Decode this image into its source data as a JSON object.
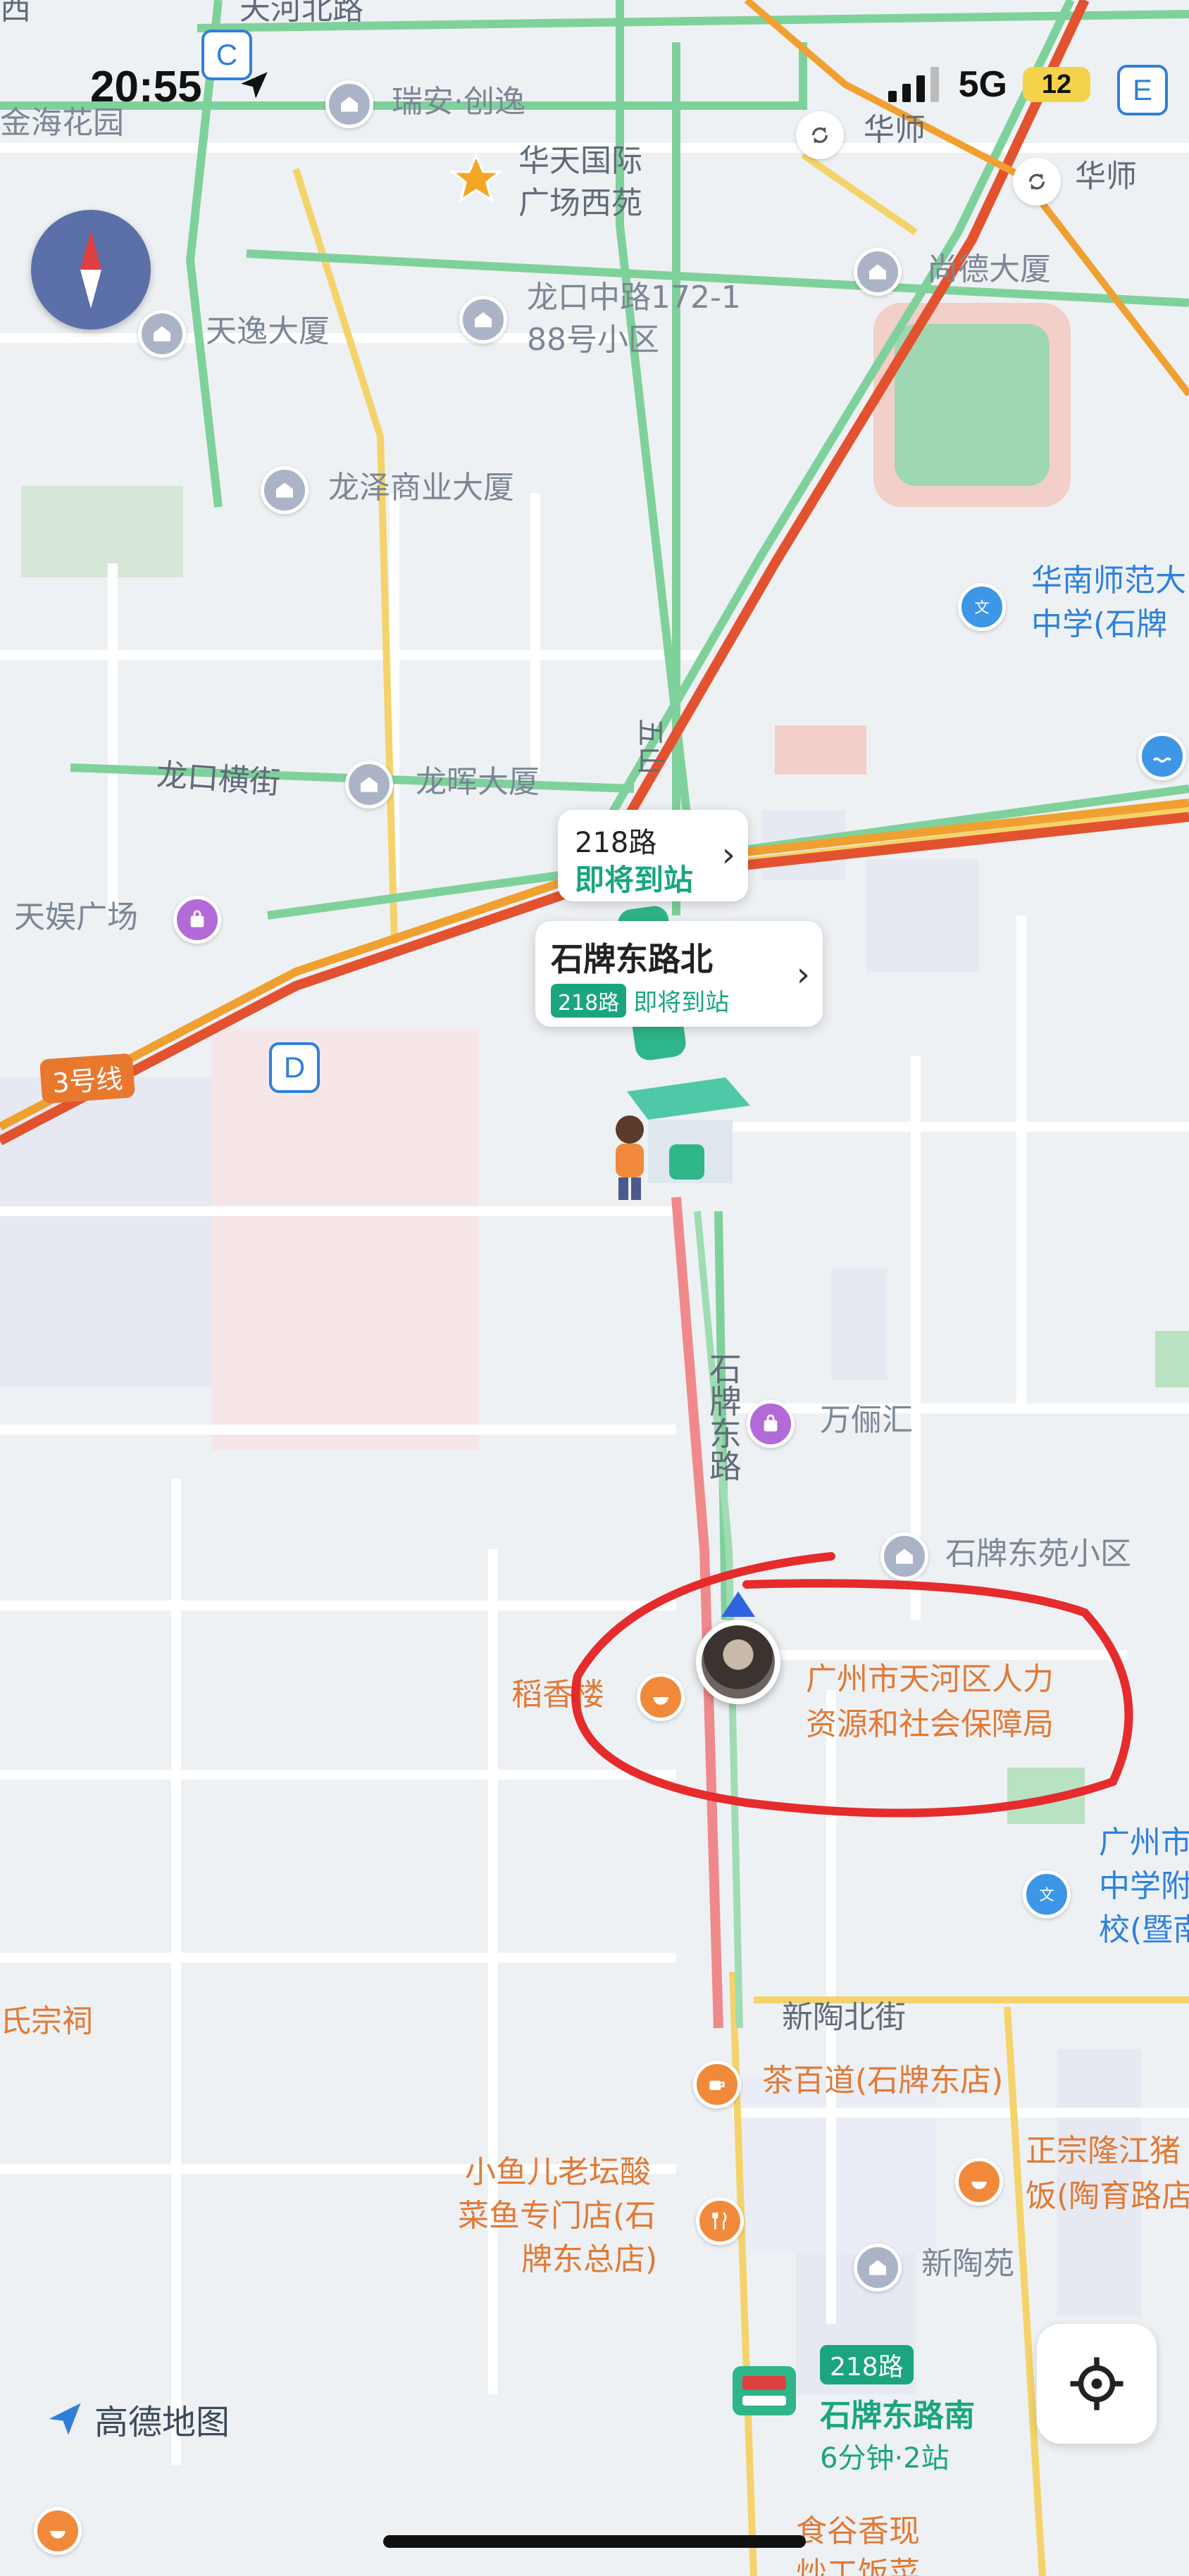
{
  "status_bar": {
    "time": "20:55",
    "network": "5G",
    "battery": "12"
  },
  "badges": {
    "top_left": "C",
    "top_right": "E",
    "metro": "D"
  },
  "labels": {
    "tianhe_north": "天河北路",
    "xi": "西",
    "jinhai": "金海花园",
    "ruian": "瑞安·创逸",
    "huatian_1": "华天国际",
    "huatian_2": "广场西苑",
    "huashi_1": "华师",
    "huashi_2": "华师",
    "shangde": "尚德大厦",
    "longkou_1": "龙口中路172-1",
    "longkou_2": "88号小区",
    "tianyi": "天逸大厦",
    "longze": "龙泽商业大厦",
    "huanan_1": "华南师范大",
    "huanan_2": "中学(石牌",
    "longkou_heng": "龙口横街",
    "longhui": "龙晖大厦",
    "tianyu": "天娱广场",
    "line3": "3号线",
    "wushan": "五山",
    "shipai_east_rd": "石牌东路",
    "wanlihui": "万俪汇",
    "shipai_dongyuan": "石牌东苑小区",
    "daoxiang": "稻香楼",
    "hr_bureau_1": "广州市天河区人力",
    "hr_bureau_2": "资源和社会保障局",
    "gz_school_1": "广州市",
    "gz_school_2": "中学附",
    "gz_school_3": "校(暨南",
    "shi_ancestral": "氏宗祠",
    "xintao_north": "新陶北街",
    "chabaidao": "茶百道(石牌东店)",
    "xiaoyuer_1": "小鱼儿老坛酸",
    "xiaoyuer_2": "菜鱼专门店(石",
    "xiaoyuer_3": "牌东总店)",
    "zhengzong_1": "正宗隆江猪",
    "zhengzong_2": "饭(陶育路店",
    "xintaoyuan": "新陶苑",
    "shigu_1": "食谷香现",
    "shigu_2": "炒工饭菜"
  },
  "route_card": {
    "route": "218路",
    "status": "即将到站"
  },
  "stop_card": {
    "name": "石牌东路北",
    "route": "218路",
    "status": "即将到站"
  },
  "bottom_stop": {
    "route": "218路",
    "name": "石牌东路南",
    "eta": "6分钟·2站"
  },
  "logo": {
    "text": "高德地图"
  },
  "colors": {
    "accent_green": "#1aa57f",
    "road_orange": "#f0a030",
    "road_red": "#e3522f",
    "route_green": "#7fd19b",
    "annotation_red": "#e52b2b"
  }
}
